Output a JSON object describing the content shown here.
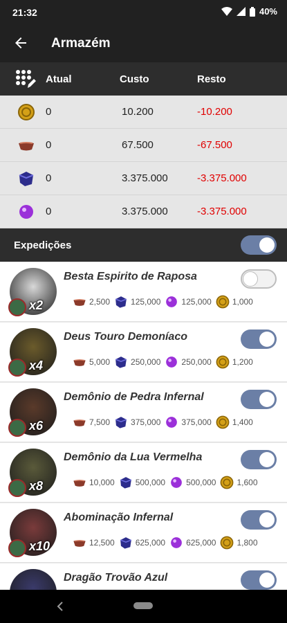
{
  "status_bar": {
    "time": "21:32",
    "battery": "40%"
  },
  "app_bar": {
    "title": "Armazém"
  },
  "storage_table": {
    "columns": [
      "Atual",
      "Custo",
      "Resto"
    ],
    "rows": [
      {
        "resource": "gold-coin",
        "atual": "0",
        "custo": "10.200",
        "resto": "-10.200"
      },
      {
        "resource": "copper-ingot",
        "atual": "0",
        "custo": "67.500",
        "resto": "-67.500"
      },
      {
        "resource": "purple-crystal",
        "atual": "0",
        "custo": "3.375.000",
        "resto": "-3.375.000"
      },
      {
        "resource": "purple-orb",
        "atual": "0",
        "custo": "3.375.000",
        "resto": "-3.375.000"
      }
    ]
  },
  "expeditions": {
    "label": "Expedições",
    "enabled": true,
    "items": [
      {
        "name": "Besta Espirito de Raposa",
        "multiplier": "x2",
        "enabled": false,
        "ingot": "2,500",
        "crystal": "125,000",
        "orb": "125,000",
        "coin": "1,000"
      },
      {
        "name": "Deus Touro Demoníaco",
        "multiplier": "x4",
        "enabled": true,
        "ingot": "5,000",
        "crystal": "250,000",
        "orb": "250,000",
        "coin": "1,200"
      },
      {
        "name": "Demônio de Pedra Infernal",
        "multiplier": "x6",
        "enabled": true,
        "ingot": "7,500",
        "crystal": "375,000",
        "orb": "375,000",
        "coin": "1,400"
      },
      {
        "name": "Demônio da Lua Vermelha",
        "multiplier": "x8",
        "enabled": true,
        "ingot": "10,000",
        "crystal": "500,000",
        "orb": "500,000",
        "coin": "1,600"
      },
      {
        "name": "Abominação Infernal",
        "multiplier": "x10",
        "enabled": true,
        "ingot": "12,500",
        "crystal": "625,000",
        "orb": "625,000",
        "coin": "1,800"
      },
      {
        "name": "Dragão Trovão Azul",
        "multiplier": "",
        "enabled": true,
        "ingot": "",
        "crystal": "",
        "orb": "",
        "coin": ""
      }
    ]
  },
  "colors": {
    "negative": "#e00000",
    "toggle_on": "#6b7fa6",
    "header_bg": "#2d2d2d"
  }
}
